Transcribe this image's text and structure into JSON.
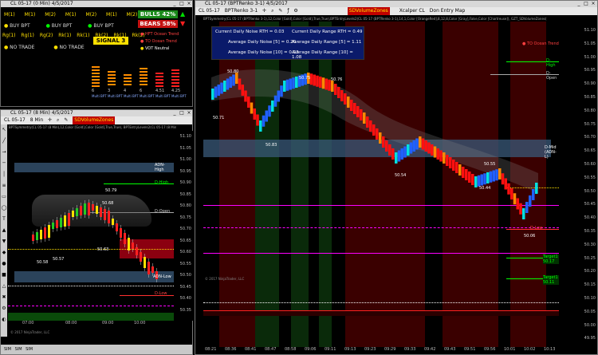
{
  "colors": {
    "bg": "#000000",
    "bull": "#00cc00",
    "bear": "#ff2020",
    "accent_yellow": "#ffe000",
    "noise_box": "#0a1a6a"
  },
  "win_market": {
    "title": "CL 05-17 (0 Min)  4/5/2017",
    "m_row": [
      "M(1)",
      "M(1)",
      "M(2)",
      "M(1)",
      "M(2)",
      "M(1)",
      "M(2)"
    ],
    "bulls": "BULLS 42%",
    "bears": "BEARS 58%",
    "buy_label": "BUY BPT",
    "r_row": [
      "Rg(1)",
      "Rg(1)",
      "Rg(2)",
      "Rk(1)",
      "Rk(1)",
      "Rk(2)",
      "Rk(1)",
      "Rk(2)"
    ],
    "signal": "SIGNAL 3",
    "no_trade": "NO TRADE",
    "hft_trend": "HFT Ocean Trend",
    "to_ocean": "TO Ocean Trend",
    "vot_neutral": "VOT Neutral",
    "multi_bpt": "Multi BPT",
    "col_values": [
      "6",
      "3",
      "4",
      "6",
      "4.51",
      "4.25"
    ]
  },
  "win_small": {
    "title": "CL 05-17 (8 Min)  4/5/2017",
    "toolbar_sym": "CL 05-17",
    "toolbar_interval": "8 Min",
    "sdvolume": "SDVolumeZones",
    "indicator_line": "BPTSymmetry(CL 05-17 (8 Min),12,Color [Gold],Color [Gold],True,True), BPTEntryLevels2(CL 05-17 (8 Min),12,Color [Gold]",
    "labels": {
      "adn_high": "ADN-High",
      "d_high": "D-High",
      "d_open": "D-Open",
      "adn_low": "ADN-Low",
      "d_low": "D-Low",
      "p1": "50.79",
      "p2": "50.63",
      "p3": "50.58",
      "p4": "50.57",
      "p5": "50.68"
    },
    "y_ticks": [
      "51.10",
      "51.05",
      "51.00",
      "50.95",
      "50.90",
      "50.85",
      "50.80",
      "50.75",
      "50.70",
      "50.65",
      "50.60",
      "50.55",
      "50.50",
      "50.45",
      "50.40",
      "50.35"
    ],
    "x_ticks": [
      "07:00",
      "08:00",
      "09:00",
      "10:00"
    ],
    "copyright": "© 2017 NinjaTrader, LLC",
    "tabs": [
      "SIM",
      "SIM",
      "SIM"
    ]
  },
  "win_main": {
    "title": "CL 05-17 (BPTRenko 3-1)  4/5/2017",
    "toolbar_sym": "CL 05-17",
    "toolbar_interval": "BPTRenko 3-1",
    "sdvolume": "SDVolumeZones",
    "xcalper": "Xcalper CL",
    "entry_map": "Don Entry Map",
    "indicator_line": "BPTSymmetry(CL 05-17 (BPTRenko 3-1),12,Color [Gold],Color [Gold],True,True),BPTEntryLevels2(CL 05-17 (BPTRenko 3-1),14,1,Color [OrangeRed],8,12,8,Color [Gray],False,Color [Chartreuse]), GZT_SDVolumeZones(",
    "noise": {
      "cur_noise": "Current Daily Noise RTH = 0.03",
      "cur_range": "Current Daily Range RTH = 0.49",
      "avg_noise5": "Average Daily Noise [5] = 0.20",
      "avg_range5": "Average Daily Range [5] = 1.11",
      "avg_noise10": "Average Daily Noise [10] = 0.23",
      "avg_range10": "Average Daily Range [10] = 1.08"
    },
    "to_ocean": "TO Ocean Trend",
    "labels": {
      "d_high": "D-High",
      "d_open": "D-Open",
      "dmid": "D-Mid (ADN-L)",
      "d_low": "D-Low",
      "target1": "Target1 50.17",
      "target2": "Target1 50.11",
      "p1": "50.80",
      "p2": "50.71",
      "p3": "50.83",
      "p4": "50.75",
      "p5": "50.76",
      "p6": "50.54",
      "p7": "50.44",
      "p8": "50.06",
      "p9": "50.55"
    },
    "y_ticks": [
      "51.10",
      "51.05",
      "51.00",
      "50.95",
      "50.90",
      "50.85",
      "50.80",
      "50.75",
      "50.70",
      "50.65",
      "50.60",
      "50.55",
      "50.50",
      "50.45",
      "50.40",
      "50.35",
      "50.30",
      "50.25",
      "50.20",
      "50.15",
      "50.10",
      "50.05",
      "50.00",
      "49.95"
    ],
    "x_ticks": [
      "08:21",
      "08:36",
      "08:41",
      "08:47",
      "08:58",
      "09:06",
      "09:11",
      "09:13",
      "09:23",
      "09:29",
      "09:33",
      "09:42",
      "09:43",
      "09:51",
      "09:56",
      "10:01",
      "10:02",
      "10:13"
    ],
    "copyright": "© 2017 NinjaTrader, LLC"
  }
}
